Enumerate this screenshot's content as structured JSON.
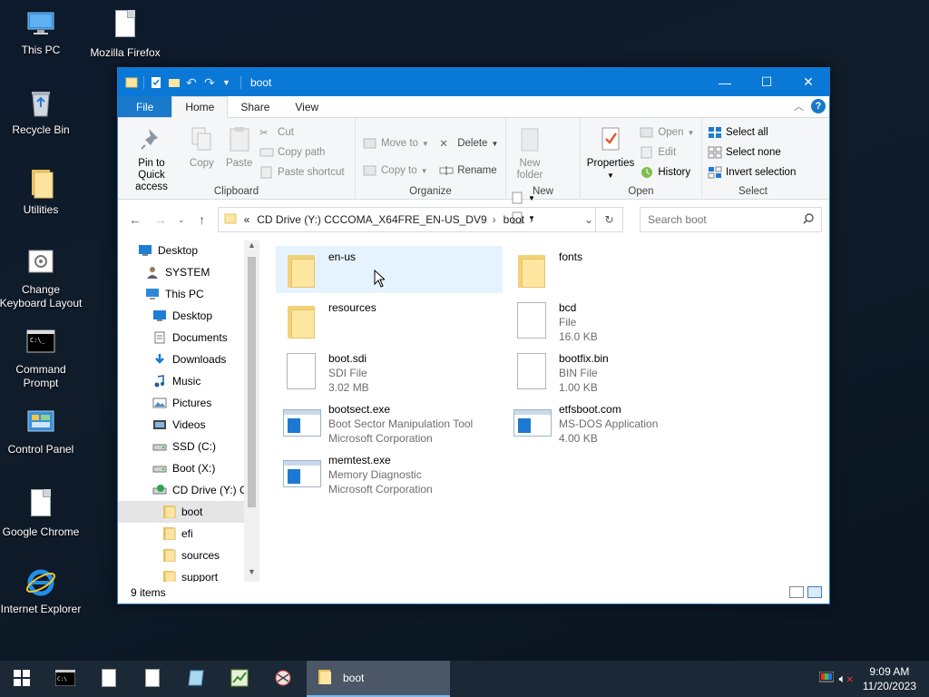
{
  "desktop": {
    "icons": [
      {
        "label": "This PC",
        "icon": "this-pc-icon"
      },
      {
        "label": "Mozilla Firefox",
        "icon": "document-icon"
      },
      {
        "label": "Recycle Bin",
        "icon": "recycle-bin-icon"
      },
      {
        "label": "Utilities",
        "icon": "folder-icon"
      },
      {
        "label": "Change Keyboard Layout",
        "icon": "keyboard-settings-icon"
      },
      {
        "label": "Command Prompt",
        "icon": "command-prompt-icon"
      },
      {
        "label": "Control Panel",
        "icon": "control-panel-icon"
      },
      {
        "label": "Google Chrome",
        "icon": "document-icon"
      },
      {
        "label": "Internet Explorer",
        "icon": "internet-explorer-icon"
      }
    ]
  },
  "window": {
    "title": "boot",
    "controls": {
      "minimize": "—",
      "maximize": "☐",
      "close": "✕"
    },
    "tabs": {
      "file": "File",
      "home": "Home",
      "share": "Share",
      "view": "View"
    },
    "ribbon": {
      "clipboard": {
        "pin": "Pin to Quick access",
        "copy": "Copy",
        "paste": "Paste",
        "cut": "Cut",
        "copy_path": "Copy path",
        "paste_shortcut": "Paste shortcut",
        "label": "Clipboard"
      },
      "organize": {
        "move_to": "Move to",
        "copy_to": "Copy to",
        "delete": "Delete",
        "rename": "Rename",
        "label": "Organize"
      },
      "new": {
        "new_folder": "New folder",
        "label": "New"
      },
      "open": {
        "properties": "Properties",
        "open": "Open",
        "edit": "Edit",
        "history": "History",
        "label": "Open"
      },
      "select": {
        "select_all": "Select all",
        "select_none": "Select none",
        "invert": "Invert selection",
        "label": "Select"
      }
    },
    "address": {
      "prefix": "«",
      "drive": "CD Drive (Y:) CCCOMA_X64FRE_EN-US_DV9",
      "folder": "boot"
    },
    "search": {
      "placeholder": "Search boot"
    },
    "nav_pane": [
      {
        "label": "Desktop",
        "icon": "desktop-icon",
        "indent": 0
      },
      {
        "label": "SYSTEM",
        "icon": "user-icon",
        "indent": 1
      },
      {
        "label": "This PC",
        "icon": "this-pc-icon",
        "indent": 1
      },
      {
        "label": "Desktop",
        "icon": "desktop-icon",
        "indent": 2
      },
      {
        "label": "Documents",
        "icon": "documents-icon",
        "indent": 2
      },
      {
        "label": "Downloads",
        "icon": "downloads-icon",
        "indent": 2
      },
      {
        "label": "Music",
        "icon": "music-icon",
        "indent": 2
      },
      {
        "label": "Pictures",
        "icon": "pictures-icon",
        "indent": 2
      },
      {
        "label": "Videos",
        "icon": "videos-icon",
        "indent": 2
      },
      {
        "label": "SSD (C:)",
        "icon": "drive-icon",
        "indent": 2
      },
      {
        "label": "Boot (X:)",
        "icon": "drive-icon",
        "indent": 2
      },
      {
        "label": "CD Drive (Y:) C",
        "icon": "cd-drive-icon",
        "indent": 2
      },
      {
        "label": "boot",
        "icon": "folder-icon",
        "indent": 3,
        "selected": true
      },
      {
        "label": "efi",
        "icon": "folder-icon",
        "indent": 3
      },
      {
        "label": "sources",
        "icon": "folder-icon",
        "indent": 3
      },
      {
        "label": "support",
        "icon": "folder-icon",
        "indent": 3
      }
    ],
    "files": [
      {
        "name": "en-us",
        "type": "",
        "detail": "",
        "kind": "folder",
        "hover": true
      },
      {
        "name": "fonts",
        "type": "",
        "detail": "",
        "kind": "folder"
      },
      {
        "name": "resources",
        "type": "",
        "detail": "",
        "kind": "folder"
      },
      {
        "name": "bcd",
        "type": "File",
        "detail": "16.0 KB",
        "kind": "file"
      },
      {
        "name": "boot.sdi",
        "type": "SDI File",
        "detail": "3.02 MB",
        "kind": "file"
      },
      {
        "name": "bootfix.bin",
        "type": "BIN File",
        "detail": "1.00 KB",
        "kind": "file"
      },
      {
        "name": "bootsect.exe",
        "type": "Boot Sector Manipulation Tool",
        "detail": "Microsoft Corporation",
        "kind": "exe"
      },
      {
        "name": "etfsboot.com",
        "type": "MS-DOS Application",
        "detail": "4.00 KB",
        "kind": "exe"
      },
      {
        "name": "memtest.exe",
        "type": "Memory Diagnostic",
        "detail": "Microsoft Corporation",
        "kind": "exe"
      }
    ],
    "status": {
      "items": "9 items"
    }
  },
  "taskbar": {
    "apps": [
      "command-prompt-icon",
      "document-icon",
      "document-icon",
      "notepad-icon",
      "task-manager-icon",
      "snipping-tool-icon"
    ],
    "active_app": "boot",
    "time": "9:09 AM",
    "date": "11/20/2023"
  },
  "colors": {
    "title_bar": "#0a78d7",
    "file_tab": "#1979ca",
    "hover": "#e5f3ff",
    "taskbar": "#1b2836"
  }
}
